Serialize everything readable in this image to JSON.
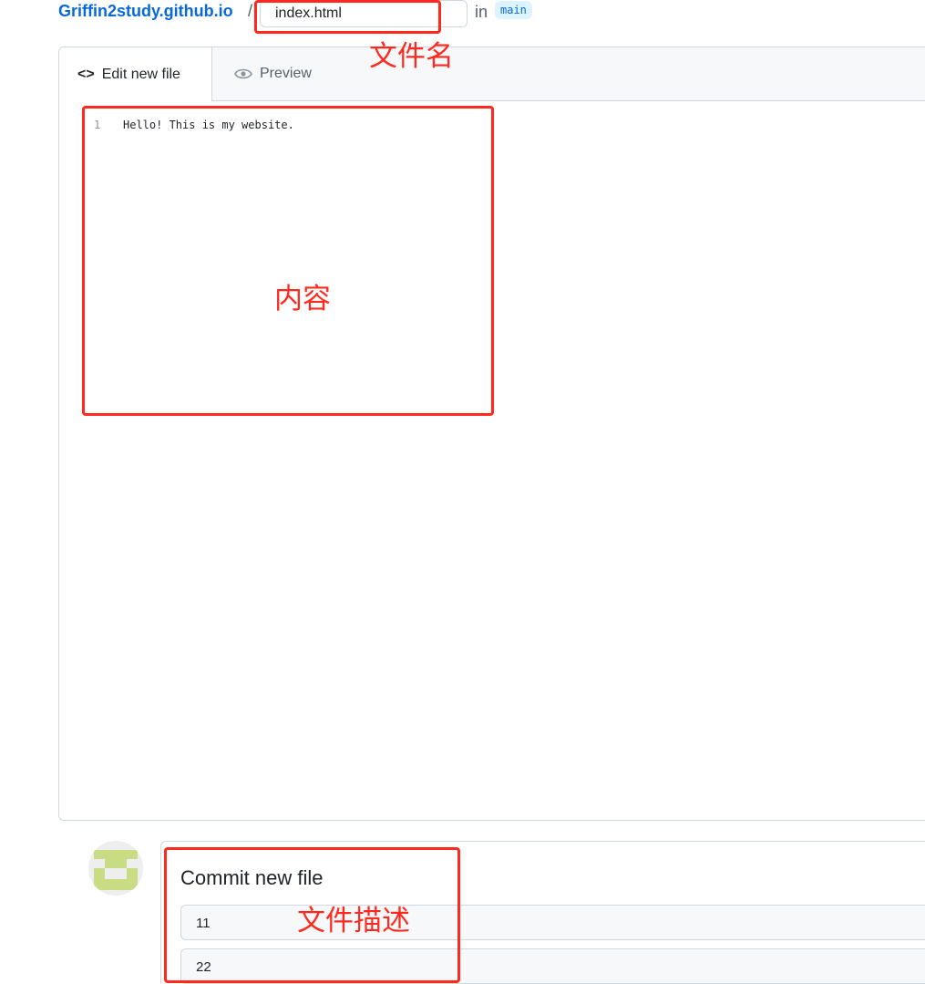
{
  "header": {
    "repo": "Griffin2study.github.io",
    "separator": "/",
    "filename": "index.html",
    "in_label": "in",
    "branch": "main"
  },
  "editor": {
    "tabs": [
      {
        "label": "Edit new file",
        "icon": "code-icon"
      },
      {
        "label": "Preview",
        "icon": "eye-icon"
      }
    ],
    "lines": [
      {
        "number": "1",
        "text": "Hello! This is my website."
      }
    ]
  },
  "commit": {
    "title": "Commit new file",
    "summary": "11",
    "description": "22"
  },
  "annotations": {
    "filename": "文件名",
    "content": "内容",
    "description": "文件描述",
    "color": "#ff2a1f"
  }
}
